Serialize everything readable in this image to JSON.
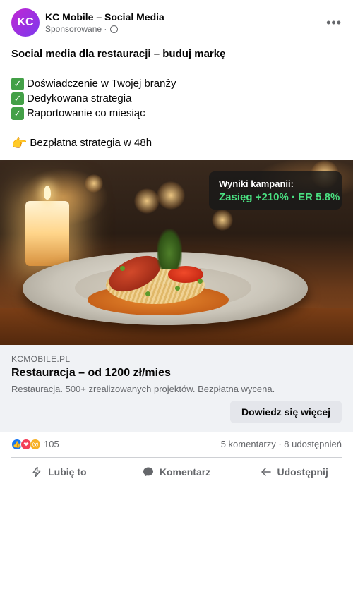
{
  "header": {
    "avatar_initials": "KC",
    "page_name": "KC Mobile – Social Media",
    "sponsored": "Sponsorowane ·",
    "more": "•••"
  },
  "post": {
    "title": "Social media dla restauracji – buduj markę",
    "bullets": [
      "Doświadczenie w Twojej branży",
      "Dedykowana strategia",
      "Raportowanie co miesiąc"
    ],
    "check_icon": "✓",
    "cta_line": "Bezpłatna strategia w 48h",
    "cta_emoji": "👉"
  },
  "image": {
    "stats_label": "Wyniki kampanii:",
    "stats_value": "Zasięg +210% · ER 5.8%",
    "stats_value_color": "#4ade80"
  },
  "link_card": {
    "domain": "KCMOBILE.PL",
    "headline": "Restauracja – od 1200 zł/mies",
    "description": "Restauracja. 500+ zrealizowanych projektów. Bezpłatna wycena.",
    "button_label": "Dowiedz się więcej"
  },
  "reactions": {
    "icons": [
      "like-icon",
      "love-icon",
      "wow-icon"
    ],
    "count": "105",
    "meta": "5 komentarzy · 8 udostępnień"
  },
  "actions": {
    "like_label": "Lubię to",
    "comment_label": "Komentarz",
    "share_label": "Udostępnij"
  }
}
